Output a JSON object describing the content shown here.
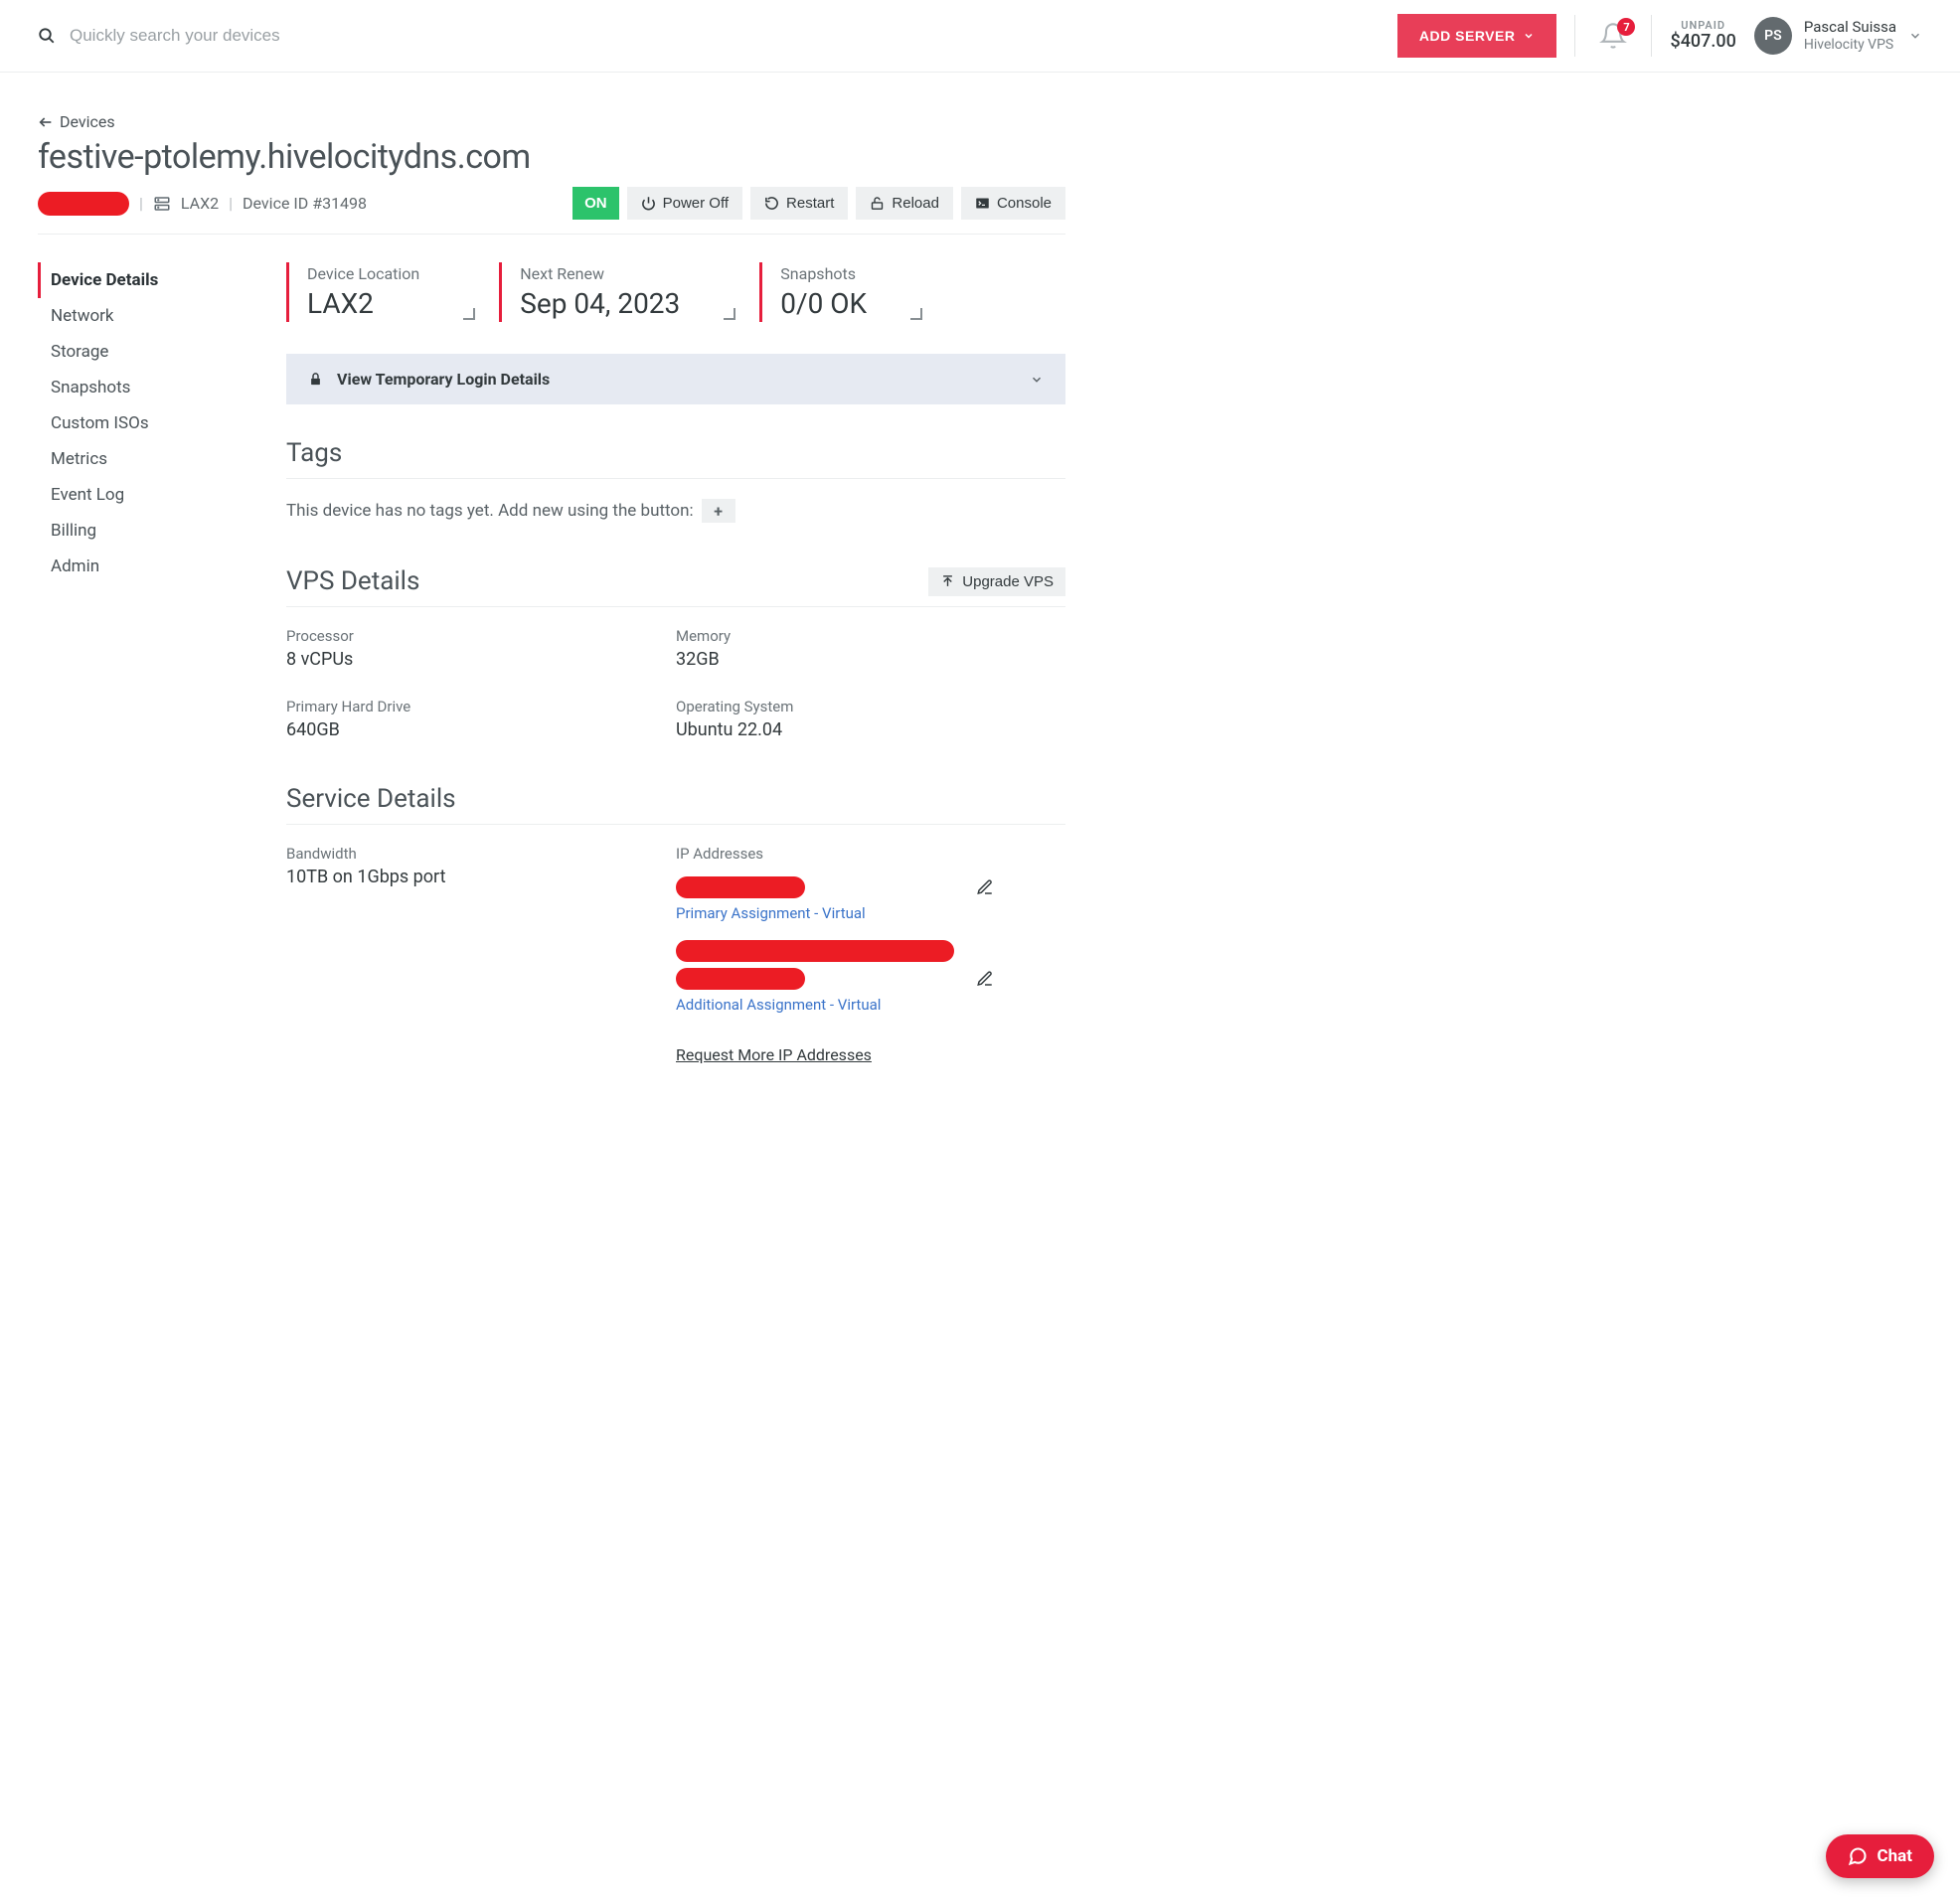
{
  "topbar": {
    "search_placeholder": "Quickly search your devices",
    "add_server_label": "ADD SERVER",
    "notification_count": "7",
    "unpaid_label": "UNPAID",
    "unpaid_amount": "$407.00",
    "avatar_initials": "PS",
    "user_name": "Pascal Suissa",
    "company_name": "Hivelocity VPS"
  },
  "header": {
    "back_label": "Devices",
    "hostname": "festive-ptolemy.hivelocitydns.com",
    "location_code": "LAX2",
    "device_id_text": "Device ID #31498"
  },
  "actions": {
    "on": "ON",
    "power_off": "Power Off",
    "restart": "Restart",
    "reload": "Reload",
    "console": "Console"
  },
  "sidebar": {
    "items": [
      "Device Details",
      "Network",
      "Storage",
      "Snapshots",
      "Custom ISOs",
      "Metrics",
      "Event Log",
      "Billing",
      "Admin"
    ],
    "active_index": 0
  },
  "cards": {
    "location_label": "Device Location",
    "location_value": "LAX2",
    "renew_label": "Next Renew",
    "renew_value": "Sep 04, 2023",
    "snapshots_label": "Snapshots",
    "snapshots_value": "0/0 OK"
  },
  "login_bar": {
    "text": "View Temporary Login Details"
  },
  "tags": {
    "title": "Tags",
    "empty_text": "This device has no tags yet. Add new using the button:"
  },
  "vps": {
    "title": "VPS Details",
    "upgrade_label": "Upgrade VPS",
    "processor_label": "Processor",
    "processor_value": "8 vCPUs",
    "memory_label": "Memory",
    "memory_value": "32GB",
    "disk_label": "Primary Hard Drive",
    "disk_value": "640GB",
    "os_label": "Operating System",
    "os_value": "Ubuntu 22.04"
  },
  "service": {
    "title": "Service Details",
    "bandwidth_label": "Bandwidth",
    "bandwidth_value": "10TB on 1Gbps port",
    "ip_label": "IP Addresses",
    "primary_link": "Primary Assignment - Virtual",
    "additional_link": "Additional Assignment - Virtual",
    "request_link": "Request More IP Addresses"
  },
  "chat": {
    "label": "Chat"
  }
}
